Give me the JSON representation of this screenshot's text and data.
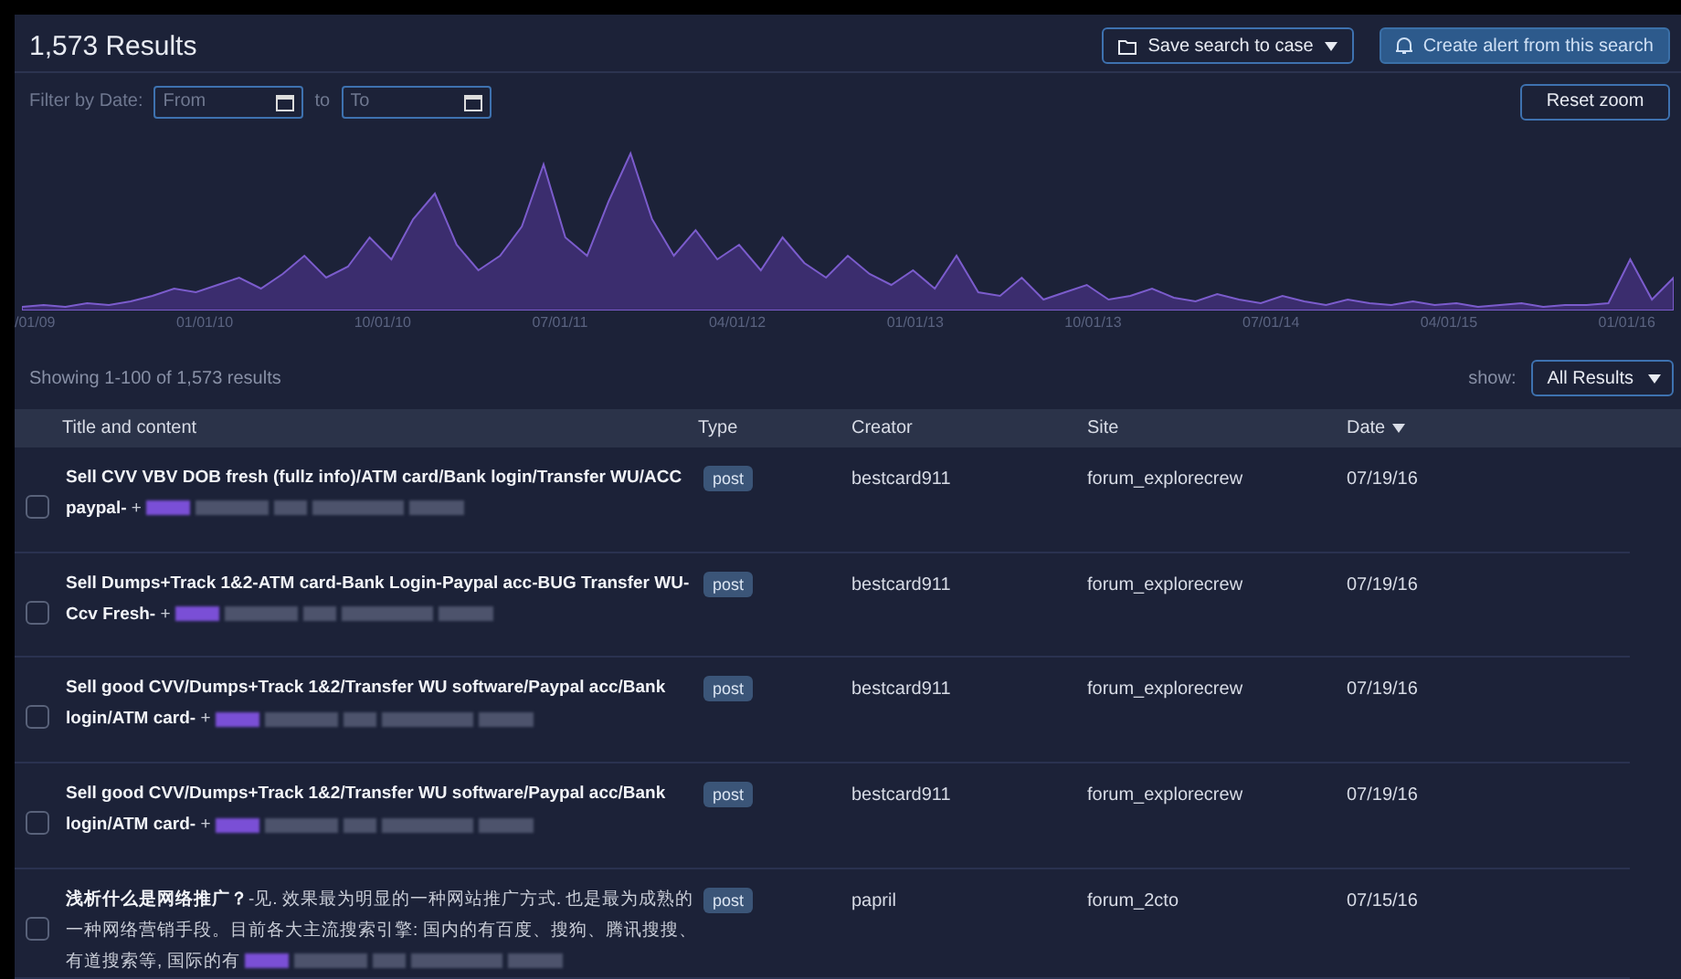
{
  "header": {
    "title": "1,573 Results",
    "save_button": "Save search to case",
    "alert_button": "Create alert from this search"
  },
  "filter": {
    "label": "Filter by Date:",
    "from_placeholder": "From",
    "to_label": "to",
    "to_placeholder": "To",
    "reset_button": "Reset zoom"
  },
  "timeline": {
    "x_labels": [
      "/01/09",
      "01/01/10",
      "10/01/10",
      "07/01/11",
      "04/01/12",
      "01/01/13",
      "10/01/13",
      "07/01/14",
      "04/01/15",
      "01/01/16"
    ]
  },
  "summary": "Showing 1-100 of 1,573 results",
  "show": {
    "label": "show:",
    "value": "All Results"
  },
  "table": {
    "columns": [
      {
        "label": "Title and content",
        "sorted": false
      },
      {
        "label": "Type",
        "sorted": false
      },
      {
        "label": "Creator",
        "sorted": false
      },
      {
        "label": "Site",
        "sorted": false
      },
      {
        "label": "Date",
        "sorted": true
      }
    ],
    "rows": [
      {
        "checked": false,
        "title": "**Sell CVV VBV DOB fresh (fullz info)/ATM card/Bank login/Transfer WU/ACC paypal-** +",
        "type": "post",
        "creator": "bestcard911",
        "site": "forum_explorecrew",
        "date": "07/19/16"
      },
      {
        "checked": false,
        "title": "**Sell Dumps+Track 1&2-ATM card-Bank Login-Paypal acc-BUG Transfer WU-Ccv Fresh-** +",
        "type": "post",
        "creator": "bestcard911",
        "site": "forum_explorecrew",
        "date": "07/19/16"
      },
      {
        "checked": false,
        "title": "**Sell good CVV/Dumps+Track 1&2/Transfer WU software/Paypal acc/Bank login/ATM card-** +",
        "type": "post",
        "creator": "bestcard911",
        "site": "forum_explorecrew",
        "date": "07/19/16"
      },
      {
        "checked": false,
        "title": "**Sell good CVV/Dumps+Track 1&2/Transfer WU software/Paypal acc/Bank login/ATM card-** +",
        "type": "post",
        "creator": "bestcard911",
        "site": "forum_explorecrew",
        "date": "07/19/16"
      },
      {
        "checked": false,
        "title": "**浅析什么是网络推广？**-见. 效果最为明显的一种网站推广方式. 也是最为成熟的一种网络营销手段。目前各大主流搜索引擎: 国内的有百度、搜狗、腾讯搜搜、有道搜索等, 国际的有",
        "type": "post",
        "creator": "papril",
        "site": "forum_2cto",
        "date": "07/15/16"
      }
    ]
  }
}
